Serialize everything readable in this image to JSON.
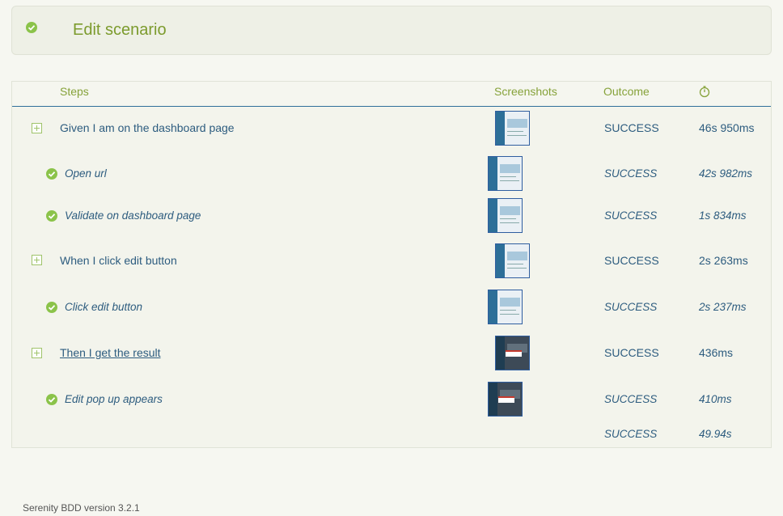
{
  "scenario": {
    "title": "Edit scenario",
    "status_icon": "check-circle-icon"
  },
  "table": {
    "headers": {
      "steps": "Steps",
      "screenshots": "Screenshots",
      "outcome": "Outcome",
      "time_icon": "stopwatch-icon"
    },
    "rows": [
      {
        "text": "Given I am on the dashboard page",
        "outcome": "SUCCESS",
        "duration": "46s 950ms"
      },
      {
        "text": "Open url",
        "outcome": "SUCCESS",
        "duration": "42s 982ms"
      },
      {
        "text": "Validate on dashboard page",
        "outcome": "SUCCESS",
        "duration": "1s 834ms"
      },
      {
        "text": "When I click edit button",
        "outcome": "SUCCESS",
        "duration": "2s 263ms"
      },
      {
        "text": "Click edit button",
        "outcome": "SUCCESS",
        "duration": "2s 237ms"
      },
      {
        "text": "Then I get the result",
        "outcome": "SUCCESS",
        "duration": "436ms"
      },
      {
        "text": "Edit pop up appears",
        "outcome": "SUCCESS",
        "duration": "410ms"
      }
    ],
    "total": {
      "outcome": "SUCCESS",
      "duration": "49.94s"
    }
  },
  "colors": {
    "success": "#8bc34a",
    "heading": "#7c9b2d",
    "text": "#2d5c7f"
  },
  "footer": {
    "version": "Serenity BDD version 3.2.1"
  }
}
